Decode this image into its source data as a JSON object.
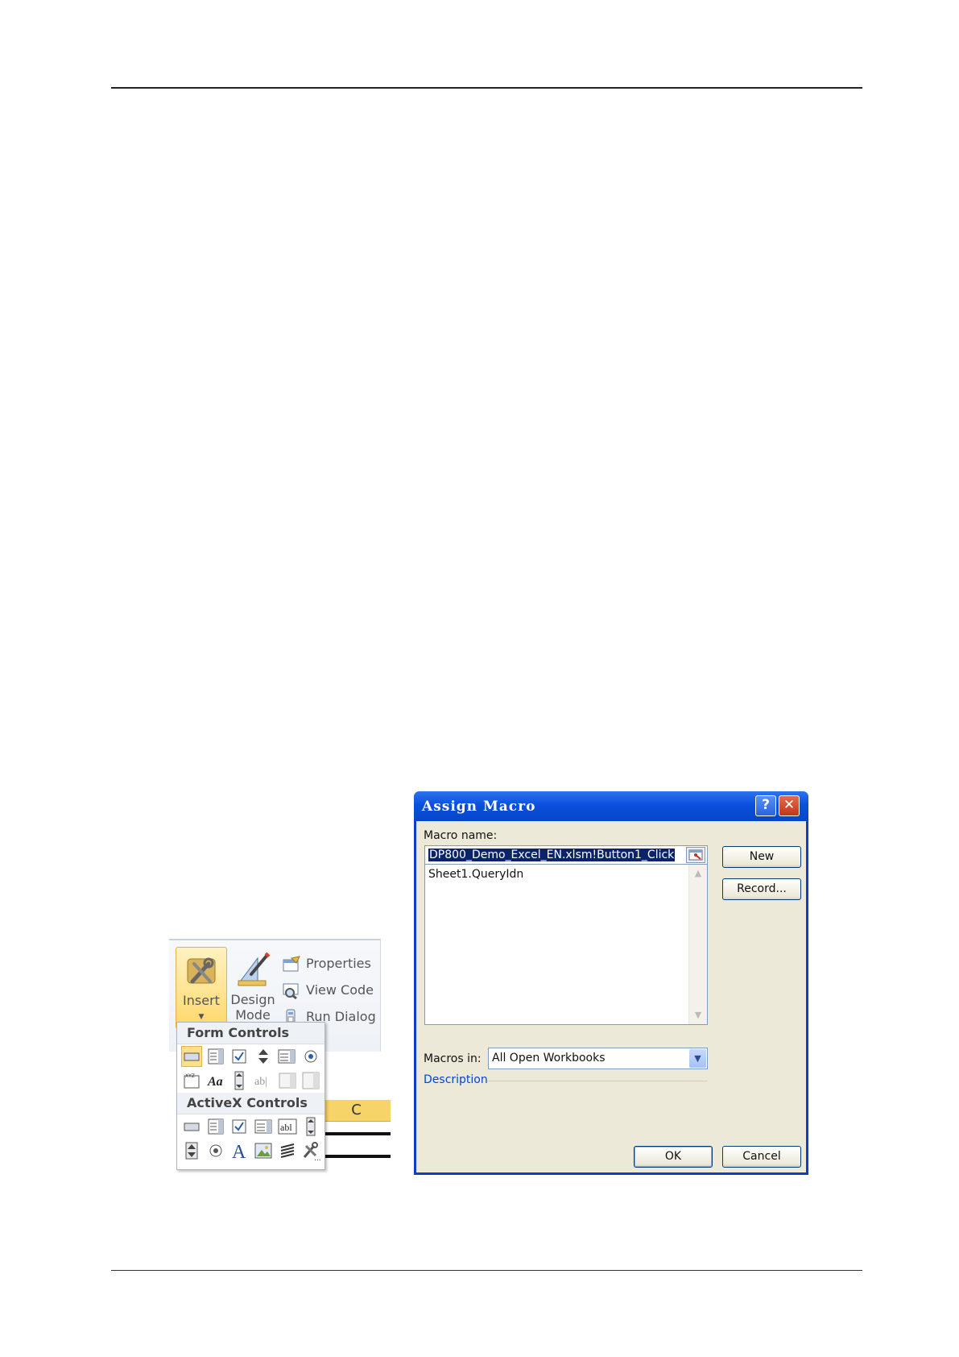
{
  "ribbon": {
    "insert_label": "Insert",
    "design_label_1": "Design",
    "design_label_2": "Mode",
    "properties_label": "Properties",
    "view_code_label": "View Code",
    "run_dialog_label": "Run Dialog",
    "column_header": "C"
  },
  "gallery": {
    "form_controls_title": "Form Controls",
    "activex_controls_title": "ActiveX Controls"
  },
  "dialog": {
    "title": "Assign Macro",
    "help_glyph": "?",
    "close_glyph": "✕",
    "macro_name_label": "Macro name:",
    "macro_name_value": "DP800_Demo_Excel_EN.xlsm!Button1_Click",
    "macro_list": [
      "Sheet1.QueryIdn"
    ],
    "new_button": "New",
    "record_button": "Record...",
    "macros_in_label": "Macros in:",
    "macros_in_value": "All Open Workbooks",
    "description_label": "Description",
    "ok_button": "OK",
    "cancel_button": "Cancel"
  }
}
